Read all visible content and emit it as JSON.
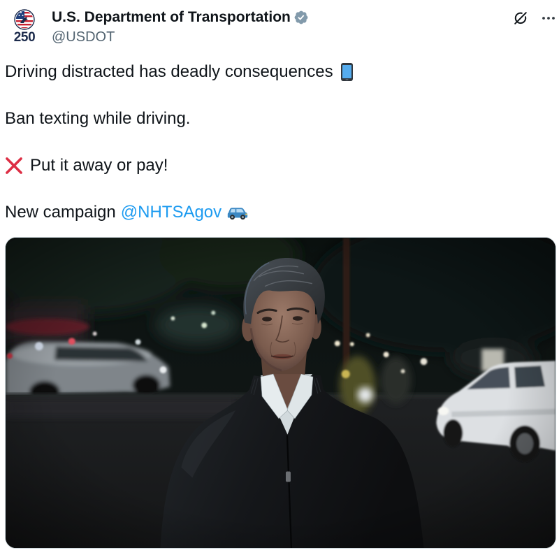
{
  "post": {
    "author": {
      "avatar_icon": "america-250-seal-icon",
      "avatar_caption": "250",
      "name": "U.S. Department of Transportation",
      "verified_badge_icon": "verified-badge-icon",
      "handle": "@USDOT"
    },
    "header_actions": {
      "grok_icon": "grok-icon",
      "more_icon": "more-icon"
    },
    "text": {
      "line_1": {
        "text": "Driving distracted has deadly consequences",
        "trailing_emoji_icon": "mobile-phone-icon"
      },
      "line_2": {
        "text": "Ban texting while driving."
      },
      "line_3": {
        "leading_emoji_icon": "cross-mark-icon",
        "text": "Put it away or pay!"
      },
      "line_4": {
        "text": "New campaign",
        "mention": "@NHTSAgov",
        "trailing_emoji_icon": "suv-car-icon"
      }
    }
  },
  "colors": {
    "text_primary": "#0f1419",
    "text_secondary": "#536471",
    "link": "#1d9bf0",
    "verified_badge": "#829aab",
    "background": "#ffffff",
    "media_border": "#cfd9de"
  }
}
